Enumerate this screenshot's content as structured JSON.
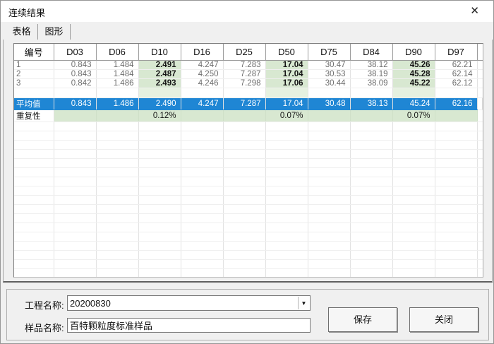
{
  "window": {
    "title": "连续结果"
  },
  "icons": {
    "close": "✕",
    "dropdown": "▼"
  },
  "tabs": [
    {
      "label": "表格",
      "selected": true
    },
    {
      "label": "图形",
      "selected": false
    }
  ],
  "table": {
    "columns": [
      "编号",
      "D03",
      "D06",
      "D10",
      "D16",
      "D25",
      "D50",
      "D75",
      "D84",
      "D90",
      "D97"
    ],
    "highlight_value_indices": [
      2,
      5,
      8
    ],
    "rows": [
      {
        "label": "1",
        "values": [
          "0.843",
          "1.484",
          "2.491",
          "4.247",
          "7.283",
          "17.04",
          "30.47",
          "38.12",
          "45.26",
          "62.21"
        ]
      },
      {
        "label": "2",
        "values": [
          "0.843",
          "1.484",
          "2.487",
          "4.250",
          "7.287",
          "17.04",
          "30.53",
          "38.19",
          "45.28",
          "62.14"
        ]
      },
      {
        "label": "3",
        "values": [
          "0.842",
          "1.486",
          "2.493",
          "4.246",
          "7.298",
          "17.06",
          "30.44",
          "38.09",
          "45.22",
          "62.12"
        ]
      }
    ],
    "average_row": {
      "label": "平均值",
      "values": [
        "0.843",
        "1.486",
        "2.490",
        "4.247",
        "7.287",
        "17.04",
        "30.48",
        "38.13",
        "45.24",
        "62.16"
      ]
    },
    "repeatability_row": {
      "label": "重复性",
      "values": [
        "",
        "",
        "0.12%",
        "",
        "",
        "0.07%",
        "",
        "",
        "0.07%",
        ""
      ]
    },
    "empty_row_count": 20
  },
  "form": {
    "project_label": "工程名称:",
    "project_value": "20200830",
    "sample_label": "样品名称:",
    "sample_value": "百特颗粒度标准样品"
  },
  "buttons": {
    "save": "保存",
    "close": "关闭"
  },
  "colors": {
    "highlight_green": "#d8e8d1",
    "average_blue": "#1f86d4",
    "dialog_bg": "#f0f0f0"
  }
}
